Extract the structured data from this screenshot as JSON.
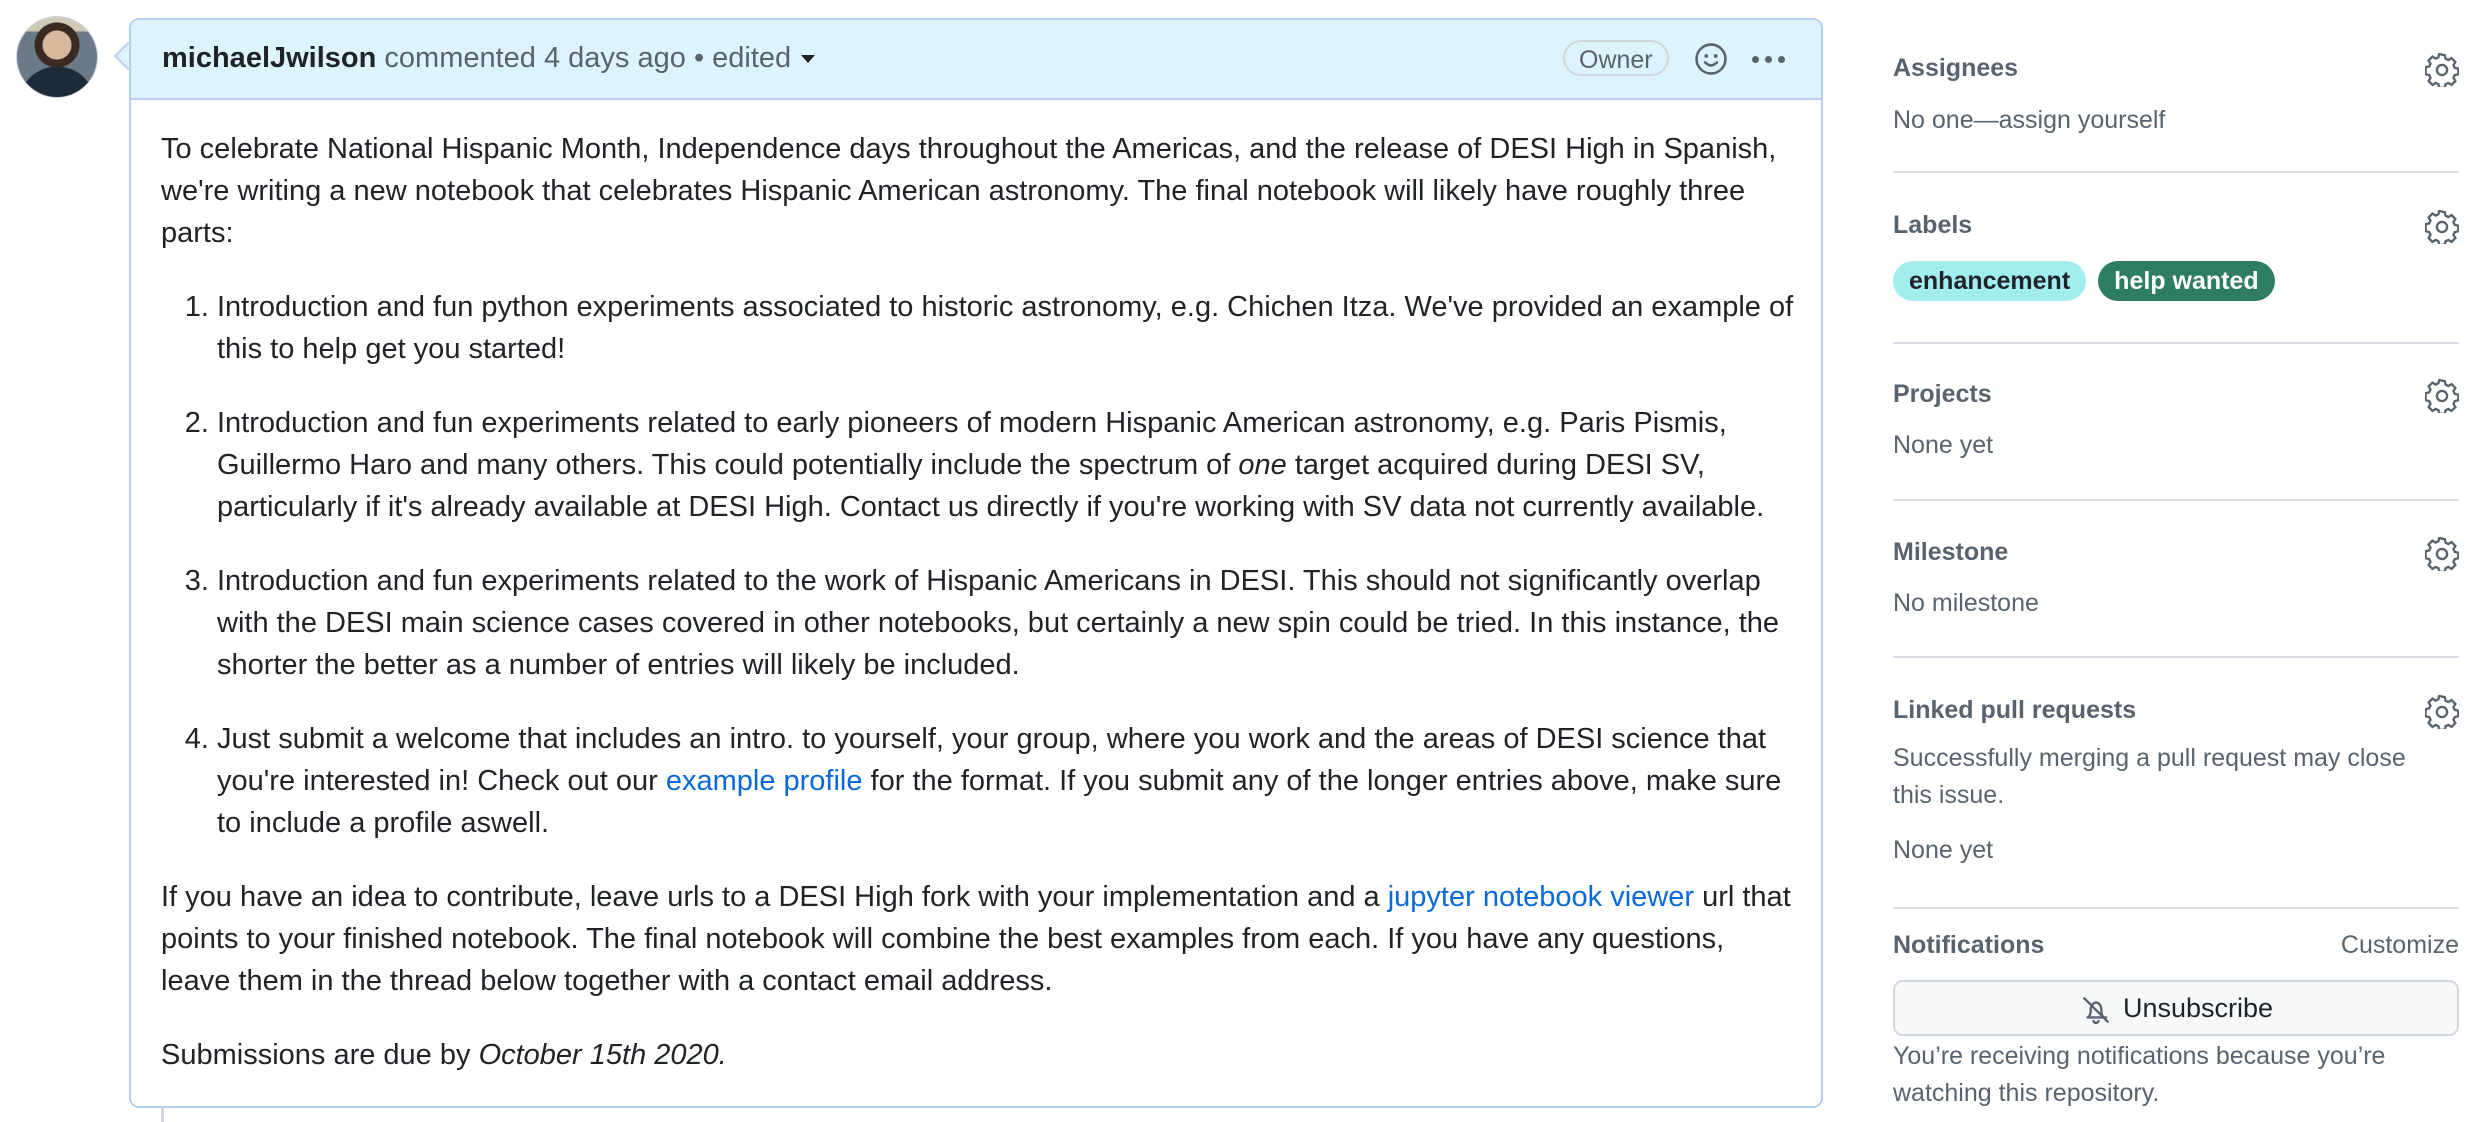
{
  "comment": {
    "author": "michaelJwilson",
    "action": "commented 4 days ago",
    "separator": "•",
    "edited": "edited",
    "badge": "Owner",
    "intro": "To celebrate National Hispanic Month, Independence days throughout the Americas, and the release of DESI High in Spanish, we're writing a new notebook that celebrates Hispanic American astronomy. The final notebook will likely have roughly three parts:",
    "items": [
      {
        "text": "Introduction and fun python experiments associated to historic astronomy, e.g. Chichen Itza. We've provided an example of this to help get you started!"
      },
      {
        "before": "Introduction and fun experiments related to early pioneers of modern Hispanic American astronomy, e.g. Paris Pismis, Guillermo Haro and many others. This could potentially include the spectrum of ",
        "em": "one",
        "after": " target acquired during DESI SV, particularly if it's already available at DESI High. Contact us directly if you're working with SV data not currently available."
      },
      {
        "text": "Introduction and fun experiments related to the work of Hispanic Americans in DESI. This should not significantly overlap with the DESI main science cases covered in other notebooks, but certainly a new spin could be tried. In this instance, the shorter the better as a number of entries will likely be included."
      },
      {
        "before": "Just submit a welcome that includes an intro. to yourself, your group, where you work and the areas of DESI science that you're interested in! Check out our ",
        "link": "example profile",
        "after": " for the format. If you submit any of the longer entries above, make sure to include a profile aswell."
      }
    ],
    "outro_before": "If you have an idea to contribute, leave urls to a DESI High fork with your implementation and a ",
    "outro_link": "jupyter notebook viewer",
    "outro_after": " url that points to your finished notebook. The final notebook will combine the best examples from each. If you have any questions, leave them in the thread below together with a contact email address.",
    "due_before": "Submissions are due by ",
    "due_date": "October 15th 2020."
  },
  "sidebar": {
    "assignees": {
      "title": "Assignees",
      "value": "No one—assign yourself"
    },
    "labels": {
      "title": "Labels",
      "items": [
        {
          "name": "enhancement",
          "bg": "#a2eeef",
          "fg": "#1f2328"
        },
        {
          "name": "help wanted",
          "bg": "#2f7d61",
          "fg": "#ffffff"
        }
      ]
    },
    "projects": {
      "title": "Projects",
      "value": "None yet"
    },
    "milestone": {
      "title": "Milestone",
      "value": "No milestone"
    },
    "linked_prs": {
      "title": "Linked pull requests",
      "note": "Successfully merging a pull request may close this issue.",
      "value": "None yet"
    },
    "notifications": {
      "title": "Notifications",
      "customize": "Customize",
      "button": "Unsubscribe",
      "reason": "You’re receiving notifications because you’re watching this repository."
    }
  },
  "icons": {
    "avatar": "user-avatar",
    "gear": "gear-icon",
    "emoji": "smiley-icon",
    "kebab": "kebab-horizontal-icon",
    "bell": "bell-slash-icon",
    "caret": "triangle-down-icon"
  },
  "colors": {
    "header_bg": "#ddf4ff",
    "header_border": "#b6cff3",
    "link": "#0969da"
  }
}
